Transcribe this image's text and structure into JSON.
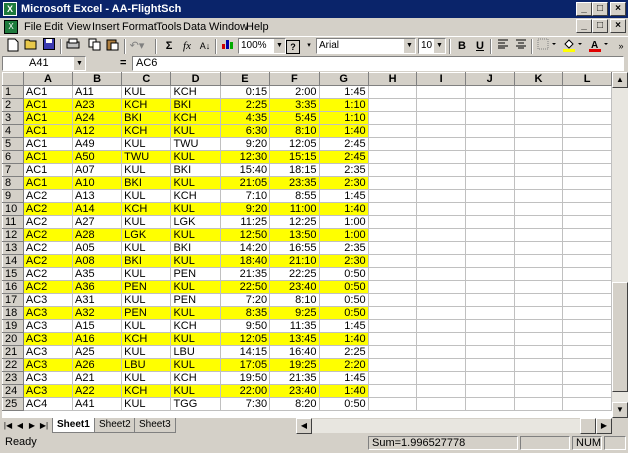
{
  "window": {
    "title": "Microsoft Excel - AA-FlightSch",
    "buttons": [
      "_",
      "□",
      "×"
    ]
  },
  "menu": {
    "items": [
      "File",
      "Edit",
      "View",
      "Insert",
      "Format",
      "Tools",
      "Data",
      "Window",
      "Help"
    ],
    "doc_buttons": [
      "_",
      "□",
      "×"
    ]
  },
  "toolbar": {
    "zoom": "100%",
    "font": "Arial",
    "font_size": "10",
    "sum_label": "Σ",
    "fx_label": "fx",
    "bold": "B",
    "underline": "U",
    "help": "?"
  },
  "formula_bar": {
    "name_box": "A41",
    "equals": "=",
    "value": "AC6"
  },
  "grid": {
    "columns": [
      "A",
      "B",
      "C",
      "D",
      "E",
      "F",
      "G",
      "H",
      "I",
      "J",
      "K",
      "L"
    ],
    "rows": [
      {
        "n": "1",
        "hl": false,
        "cells": [
          "AC1",
          "A11",
          "KUL",
          "KCH",
          "0:15",
          "2:00",
          "1:45"
        ]
      },
      {
        "n": "2",
        "hl": true,
        "cells": [
          "AC1",
          "A23",
          "KCH",
          "BKI",
          "2:25",
          "3:35",
          "1:10"
        ]
      },
      {
        "n": "3",
        "hl": true,
        "cells": [
          "AC1",
          "A24",
          "BKI",
          "KCH",
          "4:35",
          "5:45",
          "1:10"
        ]
      },
      {
        "n": "4",
        "hl": true,
        "cells": [
          "AC1",
          "A12",
          "KCH",
          "KUL",
          "6:30",
          "8:10",
          "1:40"
        ]
      },
      {
        "n": "5",
        "hl": false,
        "cells": [
          "AC1",
          "A49",
          "KUL",
          "TWU",
          "9:20",
          "12:05",
          "2:45"
        ]
      },
      {
        "n": "6",
        "hl": true,
        "cells": [
          "AC1",
          "A50",
          "TWU",
          "KUL",
          "12:30",
          "15:15",
          "2:45"
        ]
      },
      {
        "n": "7",
        "hl": false,
        "cells": [
          "AC1",
          "A07",
          "KUL",
          "BKI",
          "15:40",
          "18:15",
          "2:35"
        ]
      },
      {
        "n": "8",
        "hl": true,
        "cells": [
          "AC1",
          "A10",
          "BKI",
          "KUL",
          "21:05",
          "23:35",
          "2:30"
        ]
      },
      {
        "n": "9",
        "hl": false,
        "cells": [
          "AC2",
          "A13",
          "KUL",
          "KCH",
          "7:10",
          "8:55",
          "1:45"
        ]
      },
      {
        "n": "10",
        "hl": true,
        "cells": [
          "AC2",
          "A14",
          "KCH",
          "KUL",
          "9:20",
          "11:00",
          "1:40"
        ]
      },
      {
        "n": "11",
        "hl": false,
        "cells": [
          "AC2",
          "A27",
          "KUL",
          "LGK",
          "11:25",
          "12:25",
          "1:00"
        ]
      },
      {
        "n": "12",
        "hl": true,
        "cells": [
          "AC2",
          "A28",
          "LGK",
          "KUL",
          "12:50",
          "13:50",
          "1:00"
        ]
      },
      {
        "n": "13",
        "hl": false,
        "cells": [
          "AC2",
          "A05",
          "KUL",
          "BKI",
          "14:20",
          "16:55",
          "2:35"
        ]
      },
      {
        "n": "14",
        "hl": true,
        "cells": [
          "AC2",
          "A08",
          "BKI",
          "KUL",
          "18:40",
          "21:10",
          "2:30"
        ]
      },
      {
        "n": "15",
        "hl": false,
        "cells": [
          "AC2",
          "A35",
          "KUL",
          "PEN",
          "21:35",
          "22:25",
          "0:50"
        ]
      },
      {
        "n": "16",
        "hl": true,
        "cells": [
          "AC2",
          "A36",
          "PEN",
          "KUL",
          "22:50",
          "23:40",
          "0:50"
        ]
      },
      {
        "n": "17",
        "hl": false,
        "cells": [
          "AC3",
          "A31",
          "KUL",
          "PEN",
          "7:20",
          "8:10",
          "0:50"
        ]
      },
      {
        "n": "18",
        "hl": true,
        "cells": [
          "AC3",
          "A32",
          "PEN",
          "KUL",
          "8:35",
          "9:25",
          "0:50"
        ]
      },
      {
        "n": "19",
        "hl": false,
        "cells": [
          "AC3",
          "A15",
          "KUL",
          "KCH",
          "9:50",
          "11:35",
          "1:45"
        ]
      },
      {
        "n": "20",
        "hl": true,
        "cells": [
          "AC3",
          "A16",
          "KCH",
          "KUL",
          "12:05",
          "13:45",
          "1:40"
        ]
      },
      {
        "n": "21",
        "hl": false,
        "cells": [
          "AC3",
          "A25",
          "KUL",
          "LBU",
          "14:15",
          "16:40",
          "2:25"
        ]
      },
      {
        "n": "22",
        "hl": true,
        "cells": [
          "AC3",
          "A26",
          "LBU",
          "KUL",
          "17:05",
          "19:25",
          "2:20"
        ]
      },
      {
        "n": "23",
        "hl": false,
        "cells": [
          "AC3",
          "A21",
          "KUL",
          "KCH",
          "19:50",
          "21:35",
          "1:45"
        ]
      },
      {
        "n": "24",
        "hl": true,
        "cells": [
          "AC3",
          "A22",
          "KCH",
          "KUL",
          "22:00",
          "23:40",
          "1:40"
        ]
      },
      {
        "n": "25",
        "hl": false,
        "cells": [
          "AC4",
          "A41",
          "KUL",
          "TGG",
          "7:30",
          "8:20",
          "0:50"
        ]
      }
    ]
  },
  "sheets": {
    "tabs": [
      "Sheet1",
      "Sheet2",
      "Sheet3"
    ],
    "active": "Sheet1"
  },
  "status": {
    "ready": "Ready",
    "sum": "Sum=1.996527778",
    "num": "NUM"
  },
  "colors": {
    "highlight": "#ffff00",
    "titlebar": "#0a246a",
    "chrome": "#d4d0c8"
  }
}
